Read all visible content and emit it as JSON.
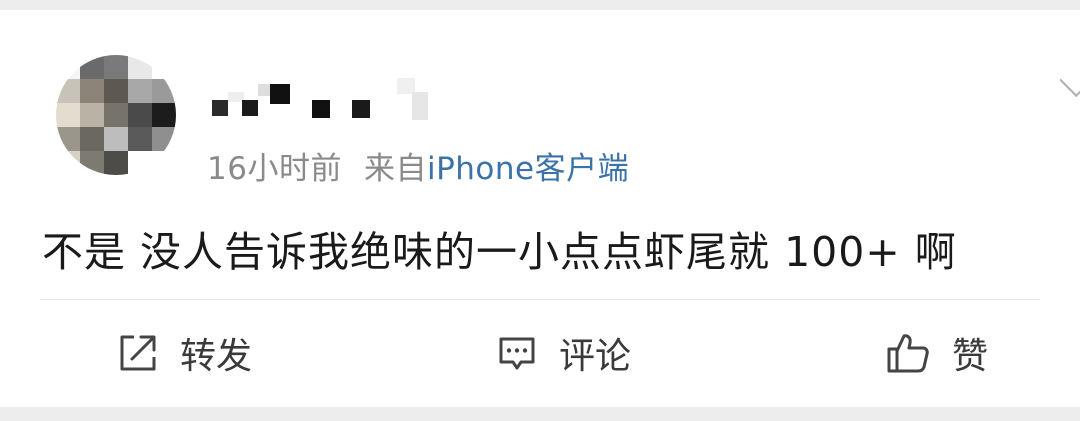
{
  "post": {
    "time": "16小时前",
    "source_prefix": "来自",
    "source_link": "iPhone客户端",
    "text": "不是 没人告诉我绝味的一小点点虾尾就 100+ 啊"
  },
  "actions": {
    "repost_label": "转发",
    "comment_label": "评论",
    "like_label": "赞"
  },
  "icons": {
    "repost": "share-icon",
    "comment": "comment-icon",
    "like": "thumbs-up-icon",
    "more": "chevron-down-icon"
  },
  "colors": {
    "link": "#3b73a8",
    "meta": "#8a8a8a",
    "text": "#1a1a1a",
    "background": "#ededed"
  }
}
